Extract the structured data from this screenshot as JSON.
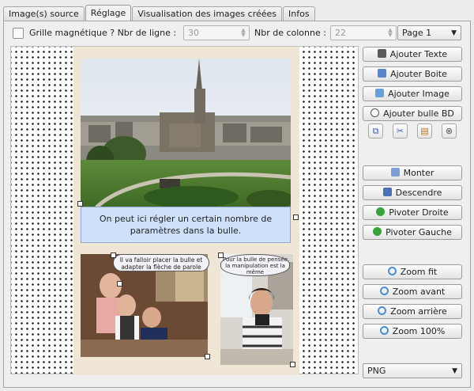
{
  "tabs": [
    {
      "label": "Image(s) source"
    },
    {
      "label": "Réglage"
    },
    {
      "label": "Visualisation des images créées"
    },
    {
      "label": "Infos"
    }
  ],
  "active_tab": "Réglage",
  "toolbar": {
    "grid_label": "Grille magnétique ? Nbr de ligne :",
    "rows_value": "30",
    "cols_label": "Nbr de colonne :",
    "cols_value": "22",
    "page_select": "Page 1"
  },
  "canvas": {
    "caption": "On peut ici régler un certain nombre de paramètres dans la bulle.",
    "bubble1": "Il va falloir placer la bulle et adapter la flèche de parole",
    "bubble2": "Pour la bulle de pensée la manipulation est la même"
  },
  "buttons": {
    "add_text": "Ajouter Texte",
    "add_box": "Ajouter Boite",
    "add_image": "Ajouter Image",
    "add_bubble": "Ajouter bulle BD",
    "up": "Monter",
    "down": "Descendre",
    "rotate_right": "Pivoter Droite",
    "rotate_left": "Pivoter Gauche",
    "zoom_fit": "Zoom fit",
    "zoom_in": "Zoom avant",
    "zoom_out": "Zoom arrière",
    "zoom_100": "Zoom 100%"
  },
  "format_select": "PNG",
  "icons": [
    "copy-icon",
    "cut-icon",
    "paste-icon",
    "delete-icon",
    "text-icon",
    "box-icon",
    "image-icon",
    "bubble-icon",
    "raise-icon",
    "lower-icon",
    "rotate-right-icon",
    "rotate-left-icon",
    "zoom-icon"
  ],
  "colors": {
    "caption_bg": "#cfe0fb",
    "page_bg": "#efe6d6",
    "rotate_green": "#3aa23a"
  }
}
